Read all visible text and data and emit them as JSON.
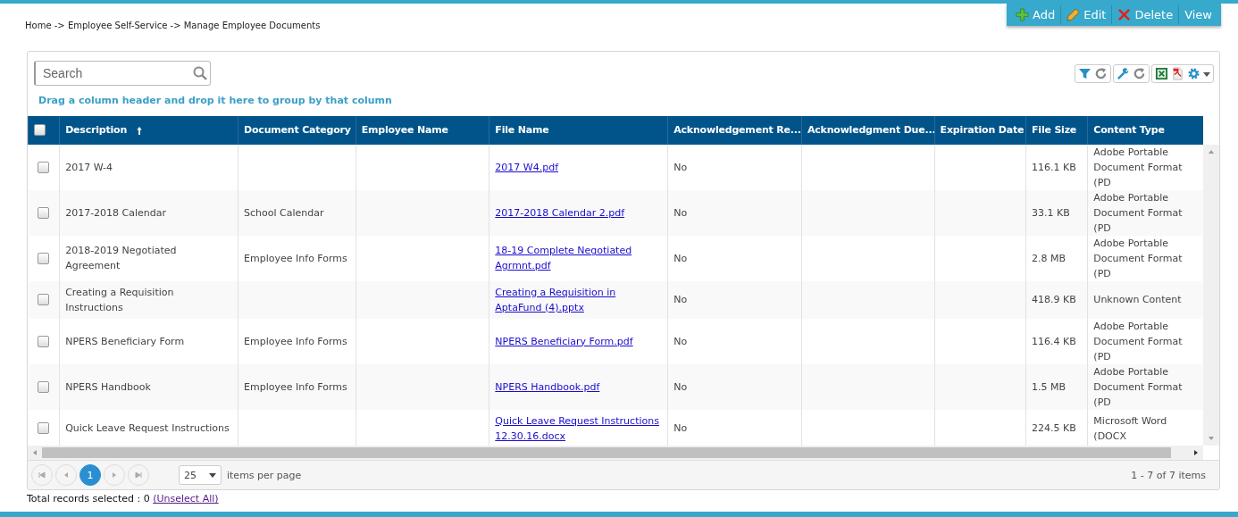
{
  "breadcrumb": "Home -> Employee Self-Service -> Manage Employee Documents",
  "actions": [
    {
      "kind": "add",
      "label": "Add"
    },
    {
      "kind": "edit",
      "label": "Edit"
    },
    {
      "kind": "delete",
      "label": "Delete"
    },
    {
      "kind": "view",
      "label": "View"
    }
  ],
  "search": {
    "placeholder": "Search"
  },
  "group_hint": "Drag a column header and drop it here to group by that column",
  "select_all": {
    "checked": false
  },
  "columns": [
    {
      "label": "Description",
      "sorted": true
    },
    {
      "label": "Document Category",
      "sorted": false
    },
    {
      "label": "Employee Name",
      "sorted": false
    },
    {
      "label": "File Name",
      "sorted": false
    },
    {
      "label": "Acknowledgement Re...",
      "sorted": false
    },
    {
      "label": "Acknowledgment Due...",
      "sorted": false
    },
    {
      "label": "Expiration Date",
      "sorted": false
    },
    {
      "label": "File Size",
      "sorted": false
    },
    {
      "label": "Content Type",
      "sorted": false
    }
  ],
  "rows": [
    {
      "checked": false,
      "cells": [
        "2017 W-4",
        "",
        "",
        "2017 W4.pdf",
        "No",
        "",
        "",
        "116.1 KB",
        "Adobe Portable Document Format (PD"
      ]
    },
    {
      "checked": false,
      "cells": [
        "2017-2018 Calendar",
        "School Calendar",
        "",
        "2017-2018 Calendar 2.pdf",
        "No",
        "",
        "",
        "33.1 KB",
        "Adobe Portable Document Format (PD"
      ]
    },
    {
      "checked": false,
      "cells": [
        "2018-2019 Negotiated Agreement",
        "Employee Info Forms",
        "",
        "18-19 Complete Negotiated Agrmnt.pdf",
        "No",
        "",
        "",
        "2.8 MB",
        "Adobe Portable Document Format (PD"
      ]
    },
    {
      "checked": false,
      "cells": [
        "Creating a Requisition Instructions",
        "",
        "",
        "Creating a Requisition in AptaFund (4).pptx",
        "No",
        "",
        "",
        "418.9 KB",
        "Unknown Content"
      ]
    },
    {
      "checked": false,
      "cells": [
        "NPERS Beneficiary Form",
        "Employee Info Forms",
        "",
        "NPERS Beneficiary Form.pdf",
        "No",
        "",
        "",
        "116.4 KB",
        "Adobe Portable Document Format (PD"
      ]
    },
    {
      "checked": false,
      "cells": [
        "NPERS Handbook",
        "Employee Info Forms",
        "",
        "NPERS Handbook.pdf",
        "No",
        "",
        "",
        "1.5 MB",
        "Adobe Portable Document Format (PD"
      ]
    },
    {
      "checked": false,
      "cells": [
        "Quick Leave Request Instructions",
        "",
        "",
        "Quick Leave Request Instructions 12.30.16.docx",
        "No",
        "",
        "",
        "224.5 KB",
        "Microsoft Word (DOCX"
      ]
    }
  ],
  "pager": {
    "pages": [
      {
        "label": "1",
        "selected": true
      }
    ],
    "page_size": "25",
    "page_size_label": "items per page",
    "range": "1 - 7 of 7 items"
  },
  "total_selected": "Total records selected : 0",
  "unselect_link": "(Unselect All)"
}
